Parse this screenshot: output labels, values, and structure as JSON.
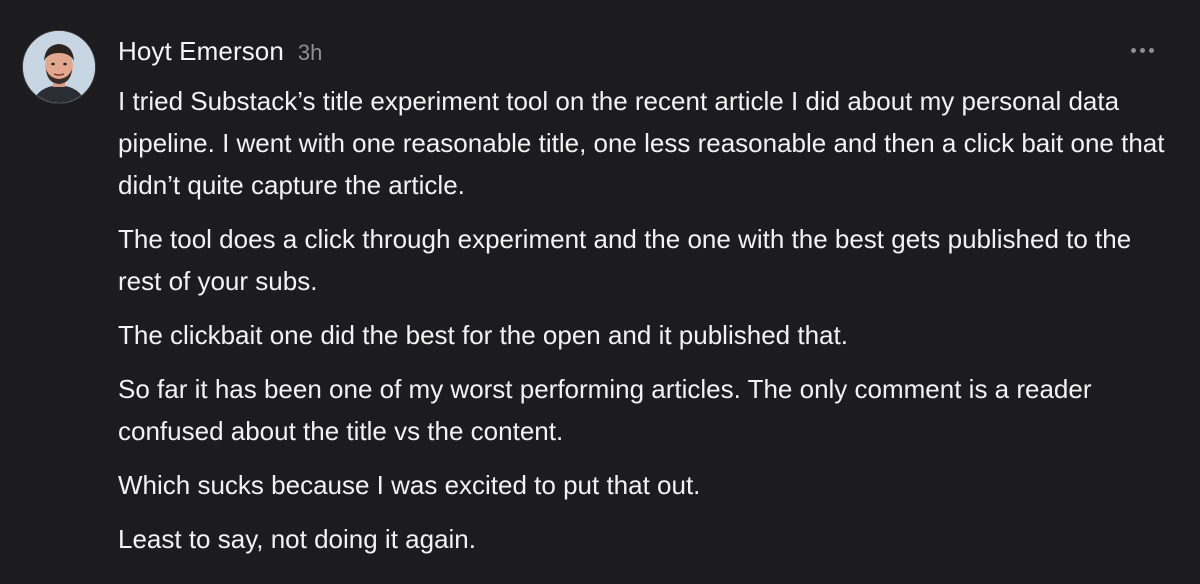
{
  "post": {
    "author": "Hoyt Emerson",
    "time": "3h",
    "menu_icon": "ellipsis-icon",
    "avatar_icon": "avatar-photo",
    "paragraphs": [
      "I tried Substack’s title experiment tool on the recent article I did about my personal data pipeline. I went with one reasonable title, one less reasonable and then a click bait one that didn’t quite capture the article.",
      "The tool does a click through experiment and the one with the best gets published to the rest of your subs.",
      "The clickbait one did the best for the open and it published that.",
      "So far it has been one of my worst performing articles. The only comment is a reader confused about the title vs the content.",
      "Which sucks because I was excited to put that out.",
      "Least to say, not doing it again."
    ]
  },
  "colors": {
    "background": "#1c1c1e",
    "text": "#f2f2f2",
    "muted": "#8e8e93"
  }
}
